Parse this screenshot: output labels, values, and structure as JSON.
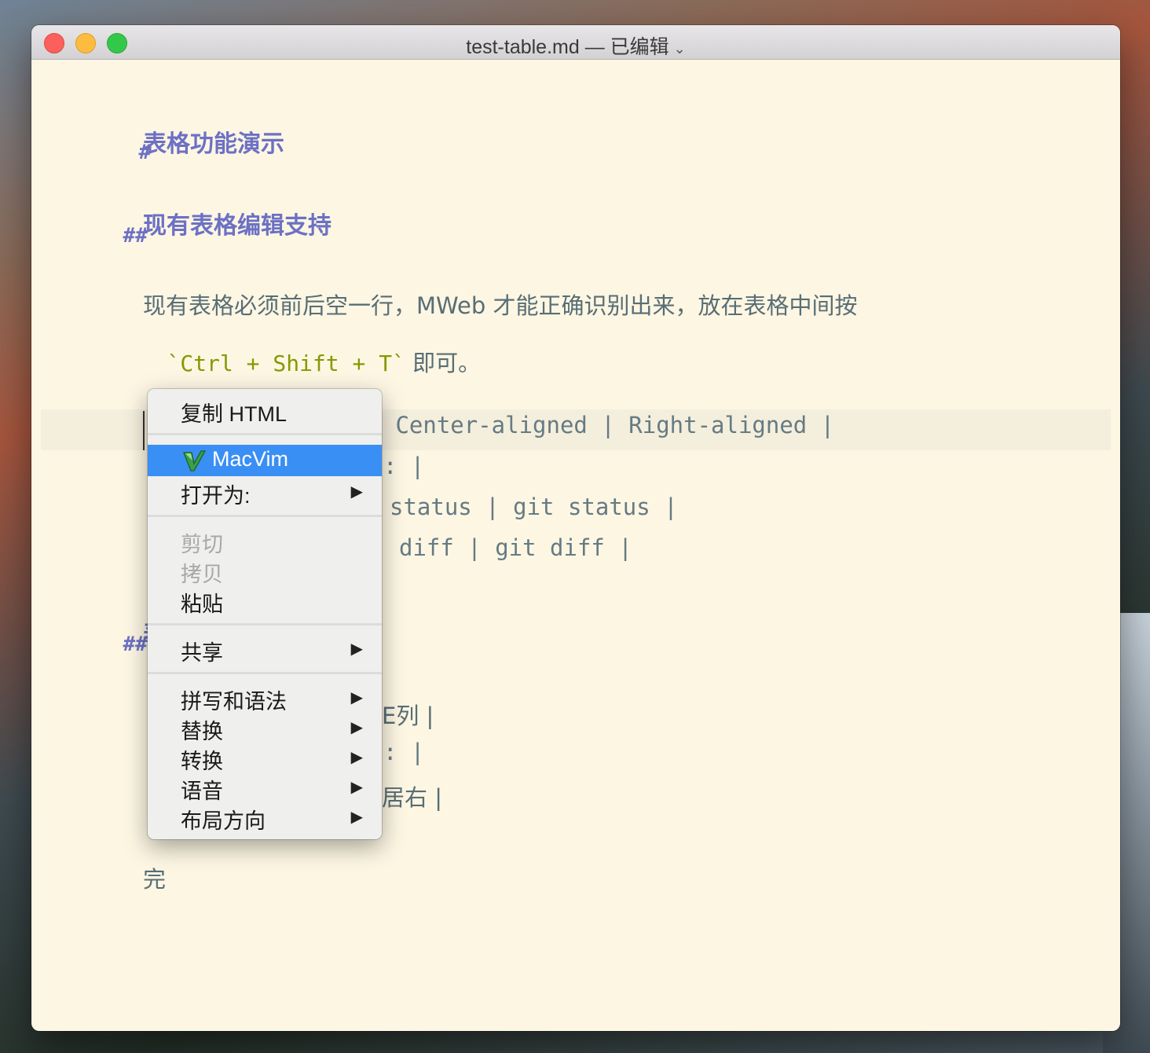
{
  "window": {
    "title": "test-table.md — 已编辑",
    "title_chevron": "⌄"
  },
  "editor": {
    "h1_marker": "#",
    "h1_text": "表格功能演示",
    "h2a_marker": "##",
    "h2a_text": "现有表格编辑支持",
    "para_line1": "现有表格必须前后空一行，MWeb 才能正确识别出来，放在表格中间按",
    "para_code": "`Ctrl + Shift + T`",
    "para_suffix": " 即可。",
    "table_row1": " Center-aligned | Right-aligned |",
    "table_row2": ": |",
    "table_row3": "status | git status |",
    "table_row4": "diff | git diff |",
    "h2b_marker": "##",
    "h2b_partial": "表",
    "table2_row1": "E列 |",
    "table2_row2": ": |",
    "table2_row3": "居右 |",
    "end_text": "完"
  },
  "context_menu": {
    "copy_html": "复制 HTML",
    "macvim": "MacVim",
    "open_as": "打开为:",
    "cut": "剪切",
    "copy": "拷贝",
    "paste": "粘贴",
    "share": "共享",
    "spelling": "拼写和语法",
    "substitutions": "替换",
    "transformations": "转换",
    "speech": "语音",
    "layout_direction": "布局方向",
    "submenu_arrow": "▶"
  },
  "colors": {
    "background": "#fdf6e3",
    "heading": "#6c71c4",
    "code": "#859900",
    "text": "#586e75",
    "menu_highlight": "#3a8ff4"
  }
}
